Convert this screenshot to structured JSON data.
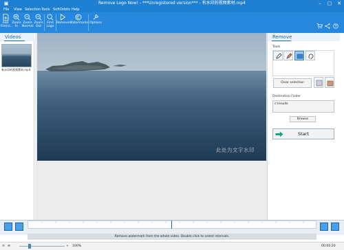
{
  "window": {
    "title": "Remove Logo Now! - ***Unregistered version*** - 有水印的视频素材.mp4"
  },
  "menu": [
    "File",
    "View",
    "Selection",
    "Tools",
    "SoftOrbits",
    "Help"
  ],
  "toolbar": {
    "add": "Add\nFile(s)...",
    "zoom_in": "Zoom\nIn",
    "zoom_normal": "Zoom\nNormal",
    "zoom_out": "Zoom\nOut",
    "find_logo": "Find\nLogo",
    "remove": "Remove",
    "watermarks": "Watermarks",
    "options": "Options"
  },
  "videos": {
    "title": "Videos",
    "items": [
      {
        "label": "有水印的视频素材.mp4"
      }
    ]
  },
  "video": {
    "watermark_text": "此处为文字水印"
  },
  "remove_panel": {
    "title": "Remove",
    "tools_label": "Tools",
    "clear_selection": "Clear selection",
    "destination_label": "Destination Folder",
    "destination_value": "c:\\results",
    "browse": "Browse",
    "start": "Start"
  },
  "timeline": {
    "hint": "Remove watermark from the whole video. Double click to select intervals."
  },
  "status": {
    "zoom": "100%",
    "time": "00:00:20"
  },
  "colors": {
    "titlebar": "#1f7fd1",
    "toolbar": "#2787dc",
    "accent": "#1b67b8",
    "selected_tool": "#9fc6ee"
  }
}
